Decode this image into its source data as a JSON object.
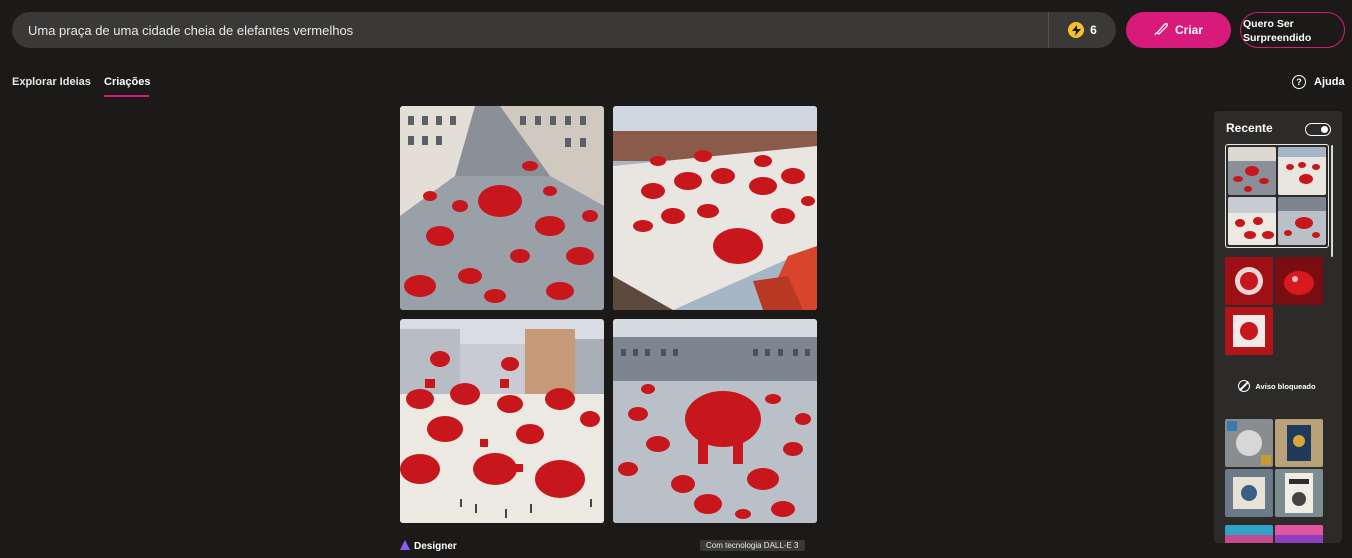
{
  "prompt": {
    "value": "Uma praça de uma cidade cheia de elefantes vermelhos"
  },
  "boosts": {
    "count": "6",
    "icon": "lightning-icon"
  },
  "create_button": {
    "label": "Criar",
    "icon": "brush-icon"
  },
  "surprise_button": {
    "label_line1": "Quero Ser",
    "label_line2": "Surpreendido"
  },
  "tabs": [
    {
      "label": "Explorar Ideias",
      "active": false
    },
    {
      "label": "Criações",
      "active": true
    }
  ],
  "help": {
    "label": "Ajuda",
    "icon": "question-circle-icon"
  },
  "results": [
    {
      "description_icon": "red-elephants-square-aerial-image"
    },
    {
      "description_icon": "red-elephants-rooftop-square-image"
    },
    {
      "description_icon": "red-elephants-gift-boxes-square-image"
    },
    {
      "description_icon": "big-red-elephant-square-image"
    }
  ],
  "footer": {
    "brand": "Designer",
    "brand_icon": "designer-logo-icon",
    "powered_by": "Com tecnologia DALL-E 3"
  },
  "recent": {
    "title": "Recente",
    "toggle_on": true,
    "blocked_label": "Aviso bloqueado",
    "blocked_icon": "prohibited-icon"
  },
  "colors": {
    "accent": "#d81b7a",
    "background": "#1b1a19",
    "surface": "#3a3938",
    "panel": "#2c2b2a",
    "elephant_red": "#c8161d"
  }
}
